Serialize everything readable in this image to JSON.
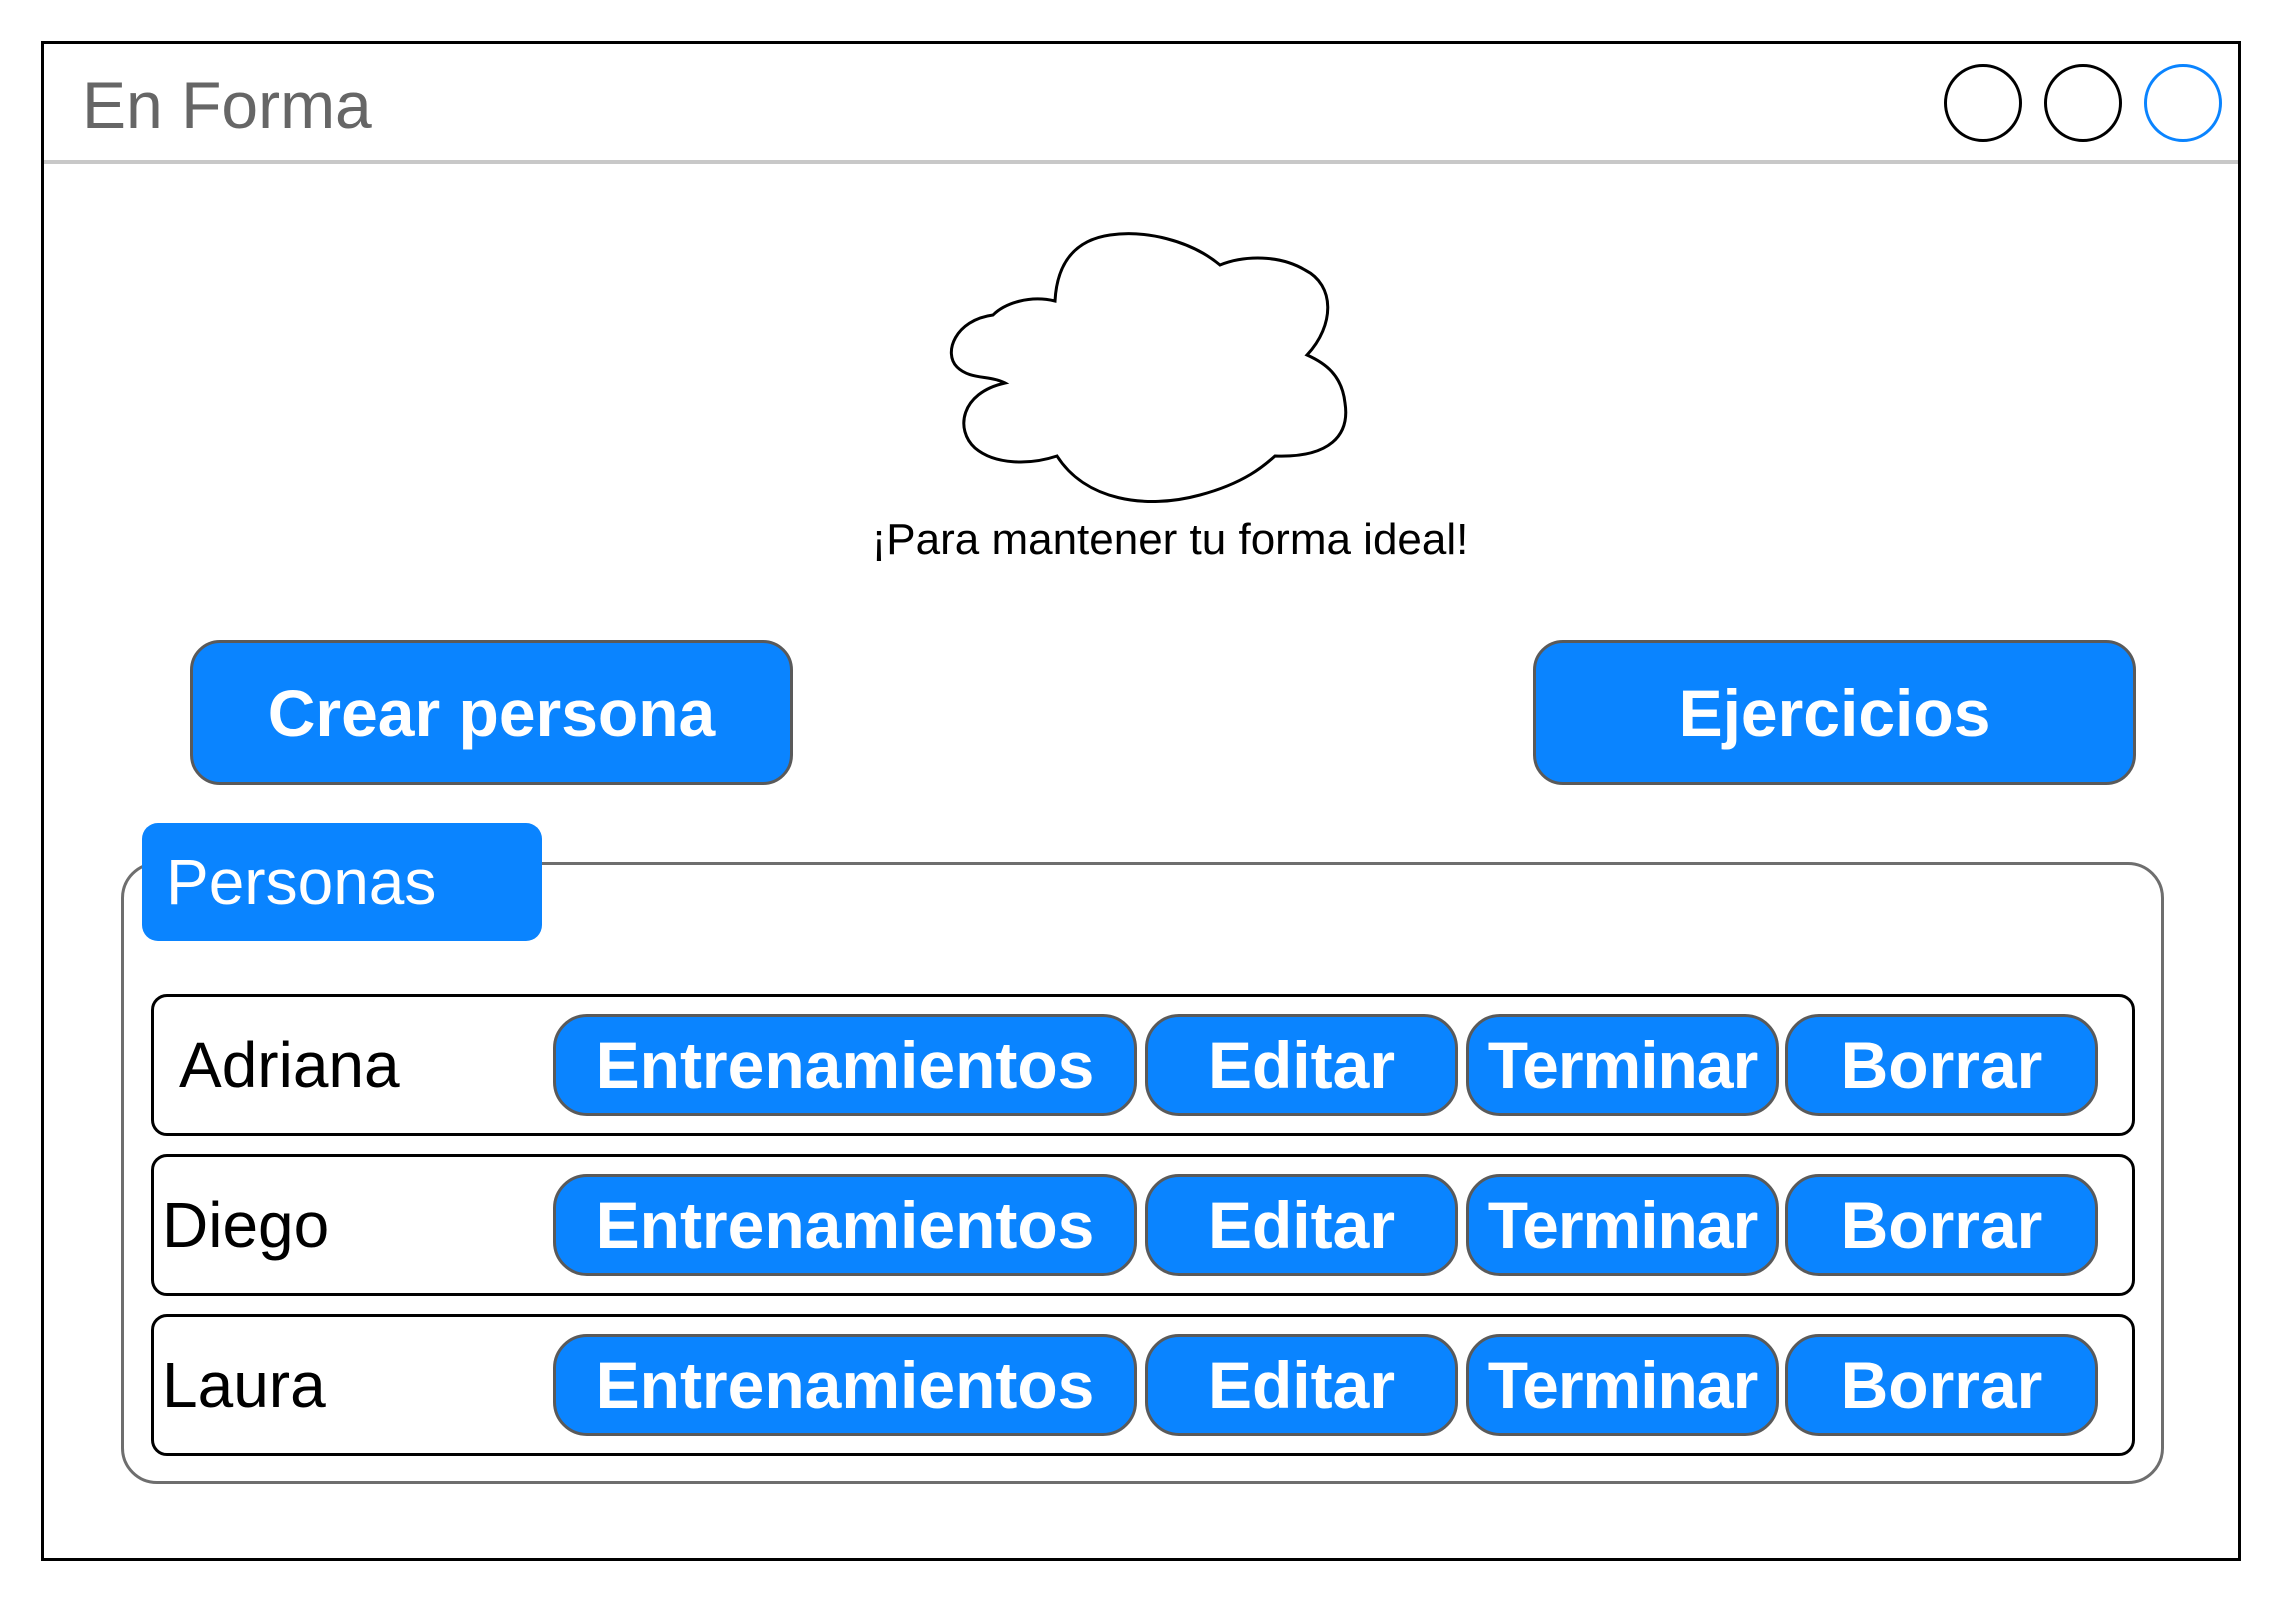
{
  "window": {
    "title": "En Forma",
    "accent_color": "#0a84ff",
    "controls": [
      "minimize-icon",
      "maximize-icon",
      "close-icon"
    ]
  },
  "header": {
    "logo_icon": "cloud-icon",
    "tagline": "¡Para mantener tu forma ideal!"
  },
  "actions": {
    "create_person_label": "Crear persona",
    "exercises_label": "Ejercicios"
  },
  "personas": {
    "group_label": "Personas",
    "rows": [
      {
        "name": "Adriana",
        "trainings_label": "Entrenamientos",
        "edit_label": "Editar",
        "finish_label": "Terminar",
        "delete_label": "Borrar"
      },
      {
        "name": "Diego",
        "trainings_label": "Entrenamientos",
        "edit_label": "Editar",
        "finish_label": "Terminar",
        "delete_label": "Borrar"
      },
      {
        "name": "Laura",
        "trainings_label": "Entrenamientos",
        "edit_label": "Editar",
        "finish_label": "Terminar",
        "delete_label": "Borrar"
      }
    ]
  }
}
